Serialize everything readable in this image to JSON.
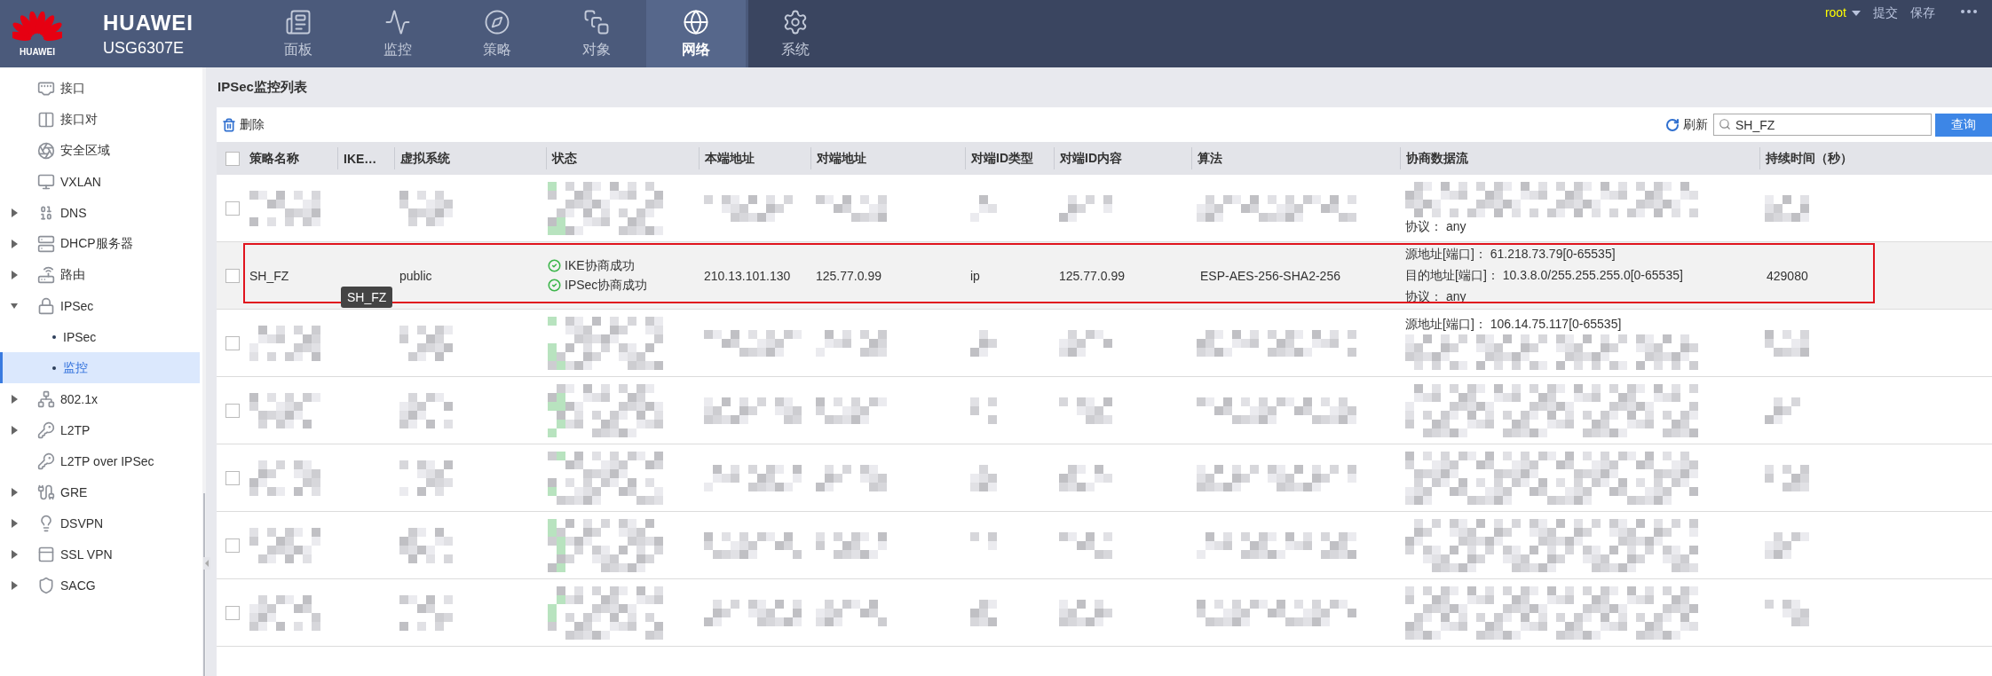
{
  "header": {
    "logo_text": "HUAWEI",
    "brand": "HUAWEI",
    "model": "USG6307E",
    "nav": [
      {
        "label": "面板",
        "selected": false
      },
      {
        "label": "监控",
        "selected": false
      },
      {
        "label": "策略",
        "selected": false
      },
      {
        "label": "对象",
        "selected": false
      },
      {
        "label": "网络",
        "selected": true
      },
      {
        "label": "系统",
        "selected": false
      }
    ],
    "user": "root",
    "actions": [
      "提交",
      "保存"
    ]
  },
  "sidebar": {
    "items": [
      {
        "label": "接口",
        "kind": "leaf"
      },
      {
        "label": "接口对",
        "kind": "leaf"
      },
      {
        "label": "安全区域",
        "kind": "leaf"
      },
      {
        "label": "VXLAN",
        "kind": "leaf"
      },
      {
        "label": "DNS",
        "kind": "group",
        "expanded": false
      },
      {
        "label": "DHCP服务器",
        "kind": "group",
        "expanded": false
      },
      {
        "label": "路由",
        "kind": "group",
        "expanded": false
      },
      {
        "label": "IPSec",
        "kind": "group",
        "expanded": true,
        "children": [
          {
            "label": "IPSec",
            "selected": false
          },
          {
            "label": "监控",
            "selected": true
          }
        ]
      },
      {
        "label": "802.1x",
        "kind": "group",
        "expanded": false
      },
      {
        "label": "L2TP",
        "kind": "group",
        "expanded": false
      },
      {
        "label": "L2TP over IPSec",
        "kind": "leaf"
      },
      {
        "label": "GRE",
        "kind": "group",
        "expanded": false
      },
      {
        "label": "DSVPN",
        "kind": "group",
        "expanded": false
      },
      {
        "label": "SSL VPN",
        "kind": "group",
        "expanded": false
      },
      {
        "label": "SACG",
        "kind": "group",
        "expanded": false
      }
    ]
  },
  "panel": {
    "title": "IPSec监控列表",
    "delete": "删除",
    "refresh": "刷新",
    "search": {
      "value": "SH_FZ"
    },
    "query": "查询",
    "table": {
      "select_all": {
        "checked": false
      },
      "columns": [
        "策略名称",
        "IKE…",
        "虚拟系统",
        "状态",
        "本端地址",
        "对端地址",
        "对端ID类型",
        "对端ID内容",
        "算法",
        "协商数据流",
        "持续时间（秒）"
      ],
      "rows": [
        {
          "kind": "redacted",
          "checked": false,
          "outlined": false,
          "flow_tail": "协议： any"
        },
        {
          "kind": "data",
          "checked": false,
          "outlined": true,
          "name": "SH_FZ",
          "vsys": "public",
          "status": [
            {
              "text": "IKE协商成功",
              "ok": true
            },
            {
              "text": "IPSec协商成功",
              "ok": true
            }
          ],
          "local": "210.13.101.130",
          "peer": "125.77.0.99",
          "id_type": "ip",
          "id_content": "125.77.0.99",
          "algorithm": "ESP-AES-256-SHA2-256",
          "flow": [
            "源地址[端口]：  61.218.73.79[0-65535]",
            "目的地址[端口]：  10.3.8.0/255.255.255.0[0-65535]",
            "协议：  any"
          ],
          "duration": "429080",
          "tooltip": "SH_FZ"
        },
        {
          "kind": "redacted",
          "checked": false,
          "outlined": false,
          "flow_head": "源地址[端口]：  106.14.75.117[0-65535]"
        },
        {
          "kind": "redacted",
          "checked": false,
          "outlined": false
        },
        {
          "kind": "redacted",
          "checked": false,
          "outlined": false
        },
        {
          "kind": "redacted",
          "checked": false,
          "outlined": false
        },
        {
          "kind": "redacted",
          "checked": false,
          "outlined": false
        }
      ]
    }
  }
}
